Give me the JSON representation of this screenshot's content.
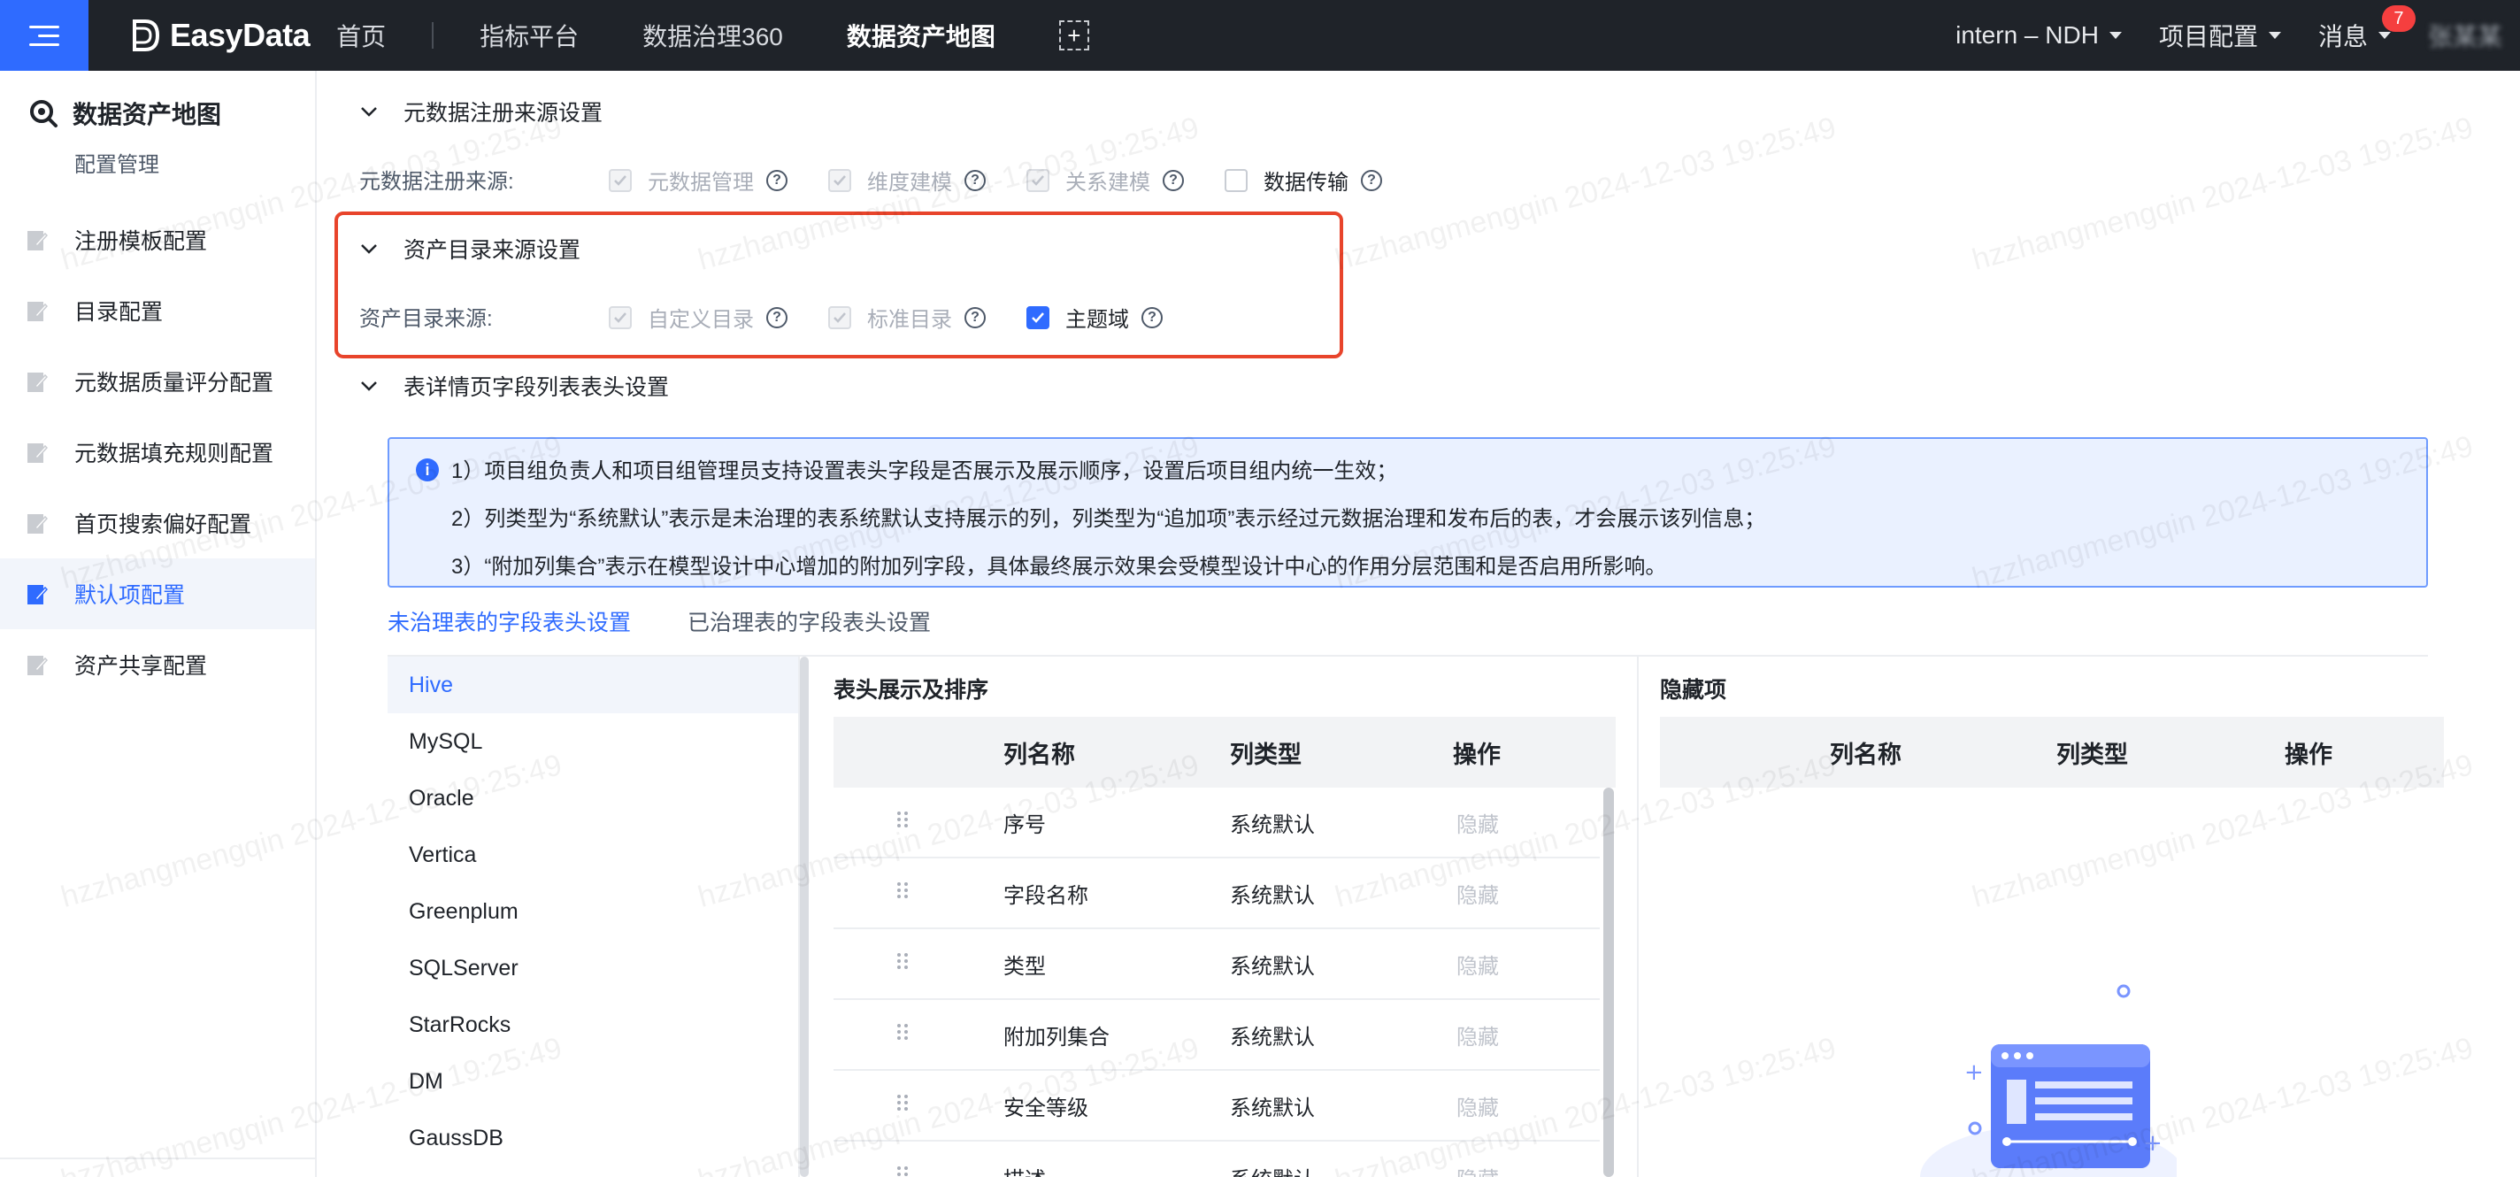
{
  "topbar": {
    "logo": "EasyData",
    "nav": [
      "首页",
      "指标平台",
      "数据治理360",
      "数据资产地图"
    ],
    "active_index": 3,
    "project": "intern – NDH",
    "project_config": "项目配置",
    "messages": "消息",
    "message_count": "7",
    "user": "张某某"
  },
  "sidebar": {
    "title": "数据资产地图",
    "subtitle": "配置管理",
    "items": [
      {
        "label": "注册模板配置"
      },
      {
        "label": "目录配置"
      },
      {
        "label": "元数据质量评分配置"
      },
      {
        "label": "元数据填充规则配置"
      },
      {
        "label": "首页搜索偏好配置"
      },
      {
        "label": "默认项配置",
        "active": true
      },
      {
        "label": "资产共享配置"
      }
    ]
  },
  "section1": {
    "title": "元数据注册来源设置",
    "label": "元数据注册来源:",
    "options": [
      {
        "label": "元数据管理",
        "state": "checked-disabled"
      },
      {
        "label": "维度建模",
        "state": "checked-disabled"
      },
      {
        "label": "关系建模",
        "state": "checked-disabled"
      },
      {
        "label": "数据传输",
        "state": "unchecked"
      }
    ]
  },
  "section2": {
    "title": "资产目录来源设置",
    "label": "资产目录来源:",
    "options": [
      {
        "label": "自定义目录",
        "state": "checked-disabled"
      },
      {
        "label": "标准目录",
        "state": "checked-disabled"
      },
      {
        "label": "主题域",
        "state": "checked"
      }
    ]
  },
  "section3": {
    "title": "表详情页字段列表表头设置",
    "info": [
      "1）项目组负责人和项目组管理员支持设置表头字段是否展示及展示顺序，设置后项目组内统一生效；",
      "2）列类型为“系统默认”表示是未治理的表系统默认支持展示的列，列类型为“追加项”表示经过元数据治理和发布后的表，才会展示该列信息；",
      "3）“附加列集合”表示在模型设计中心增加的附加列字段，具体最终展示效果会受模型设计中心的作用分层范围和是否启用所影响。"
    ],
    "tabs": [
      "未治理表的字段表头设置",
      "已治理表的字段表头设置"
    ],
    "active_tab": 0,
    "databases": [
      "Hive",
      "MySQL",
      "Oracle",
      "Vertica",
      "Greenplum",
      "SQLServer",
      "StarRocks",
      "DM",
      "GaussDB"
    ],
    "active_db": 0,
    "display_panel": {
      "title": "表头展示及排序",
      "headers": [
        "列名称",
        "列类型",
        "操作"
      ],
      "rows": [
        {
          "name": "序号",
          "type": "系统默认",
          "action": "隐藏"
        },
        {
          "name": "字段名称",
          "type": "系统默认",
          "action": "隐藏"
        },
        {
          "name": "类型",
          "type": "系统默认",
          "action": "隐藏"
        },
        {
          "name": "附加列集合",
          "type": "系统默认",
          "action": "隐藏"
        },
        {
          "name": "安全等级",
          "type": "系统默认",
          "action": "隐藏"
        },
        {
          "name": "描述",
          "type": "系统默认",
          "action": "隐藏"
        }
      ]
    },
    "hidden_panel": {
      "title": "隐藏项",
      "headers": [
        "列名称",
        "列类型",
        "操作"
      ]
    }
  },
  "watermark": "hzzhangmengqin 2024-12-03 19:25:49",
  "colors": {
    "accent": "#2f6bff",
    "topbar": "#1f2329",
    "highlight": "#e8442b"
  }
}
